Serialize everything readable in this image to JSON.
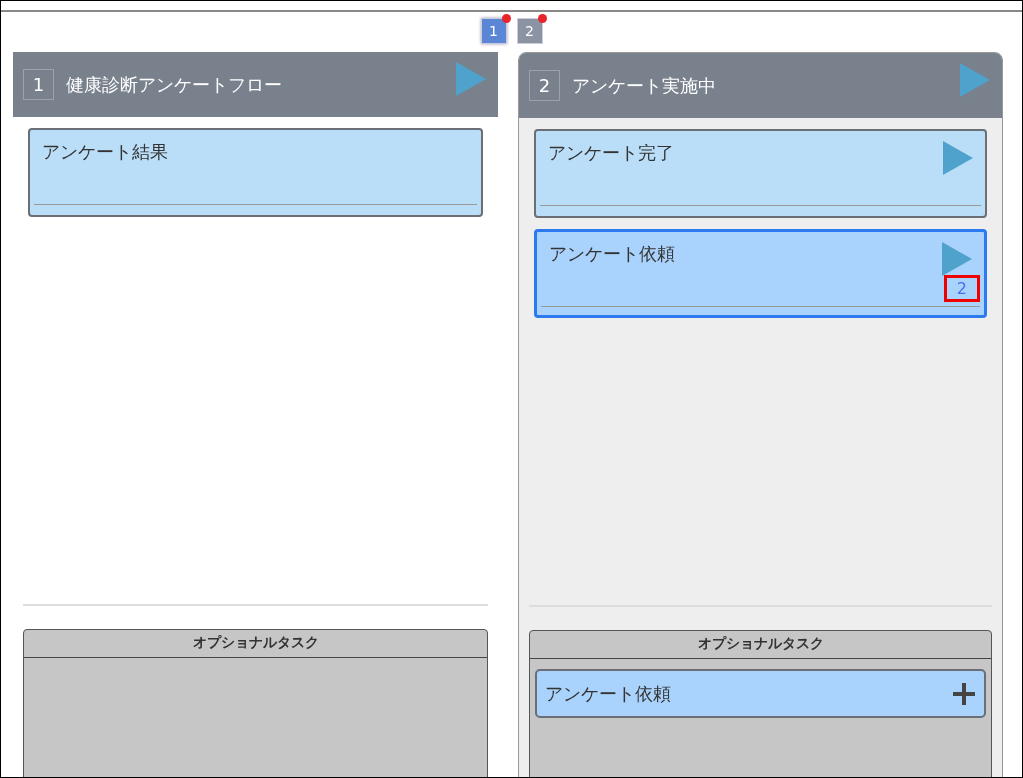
{
  "pages": [
    {
      "label": "1",
      "selected": true,
      "notification": true
    },
    {
      "label": "2",
      "selected": false,
      "notification": true
    }
  ],
  "columns": [
    {
      "number": "1",
      "title": "健康診断アンケートフロー",
      "selected": false,
      "tasks": [
        {
          "title": "アンケート結果",
          "arrow": false,
          "selected": false
        }
      ],
      "optional": {
        "title": "オプショナルタスク"
      }
    },
    {
      "number": "2",
      "title": "アンケート実施中",
      "selected": true,
      "tasks": [
        {
          "title": "アンケート完了",
          "arrow": true,
          "selected": false
        },
        {
          "title": "アンケート依頼",
          "arrow": true,
          "selected": true,
          "count": "2",
          "highlighted": true
        }
      ],
      "optional": {
        "title": "オプショナルタスク",
        "tasks": [
          {
            "title": "アンケート依頼"
          }
        ]
      }
    }
  ]
}
